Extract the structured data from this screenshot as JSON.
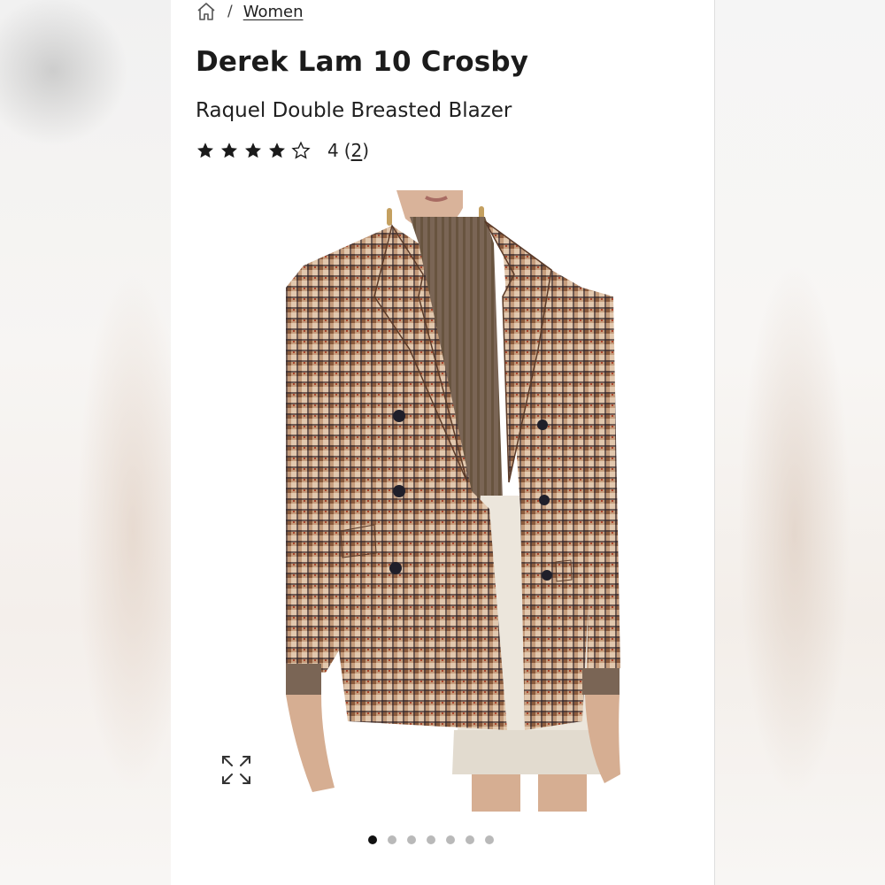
{
  "breadcrumb": {
    "home_icon": "home-icon",
    "separator": "/",
    "category": "Women"
  },
  "product": {
    "brand": "Derek Lam 10 Crosby",
    "name": "Raquel Double Breasted Blazer",
    "rating": {
      "stars_filled": 4,
      "stars_total": 5,
      "value": "4",
      "count_open": "(",
      "count": "2",
      "count_close": ")"
    }
  },
  "gallery": {
    "expand_icon": "expand-icon",
    "image_count": 7,
    "active_index": 0
  },
  "colors": {
    "text": "#1b1b1b",
    "dot_active": "#111111",
    "dot_inactive": "#b9b9b9"
  }
}
